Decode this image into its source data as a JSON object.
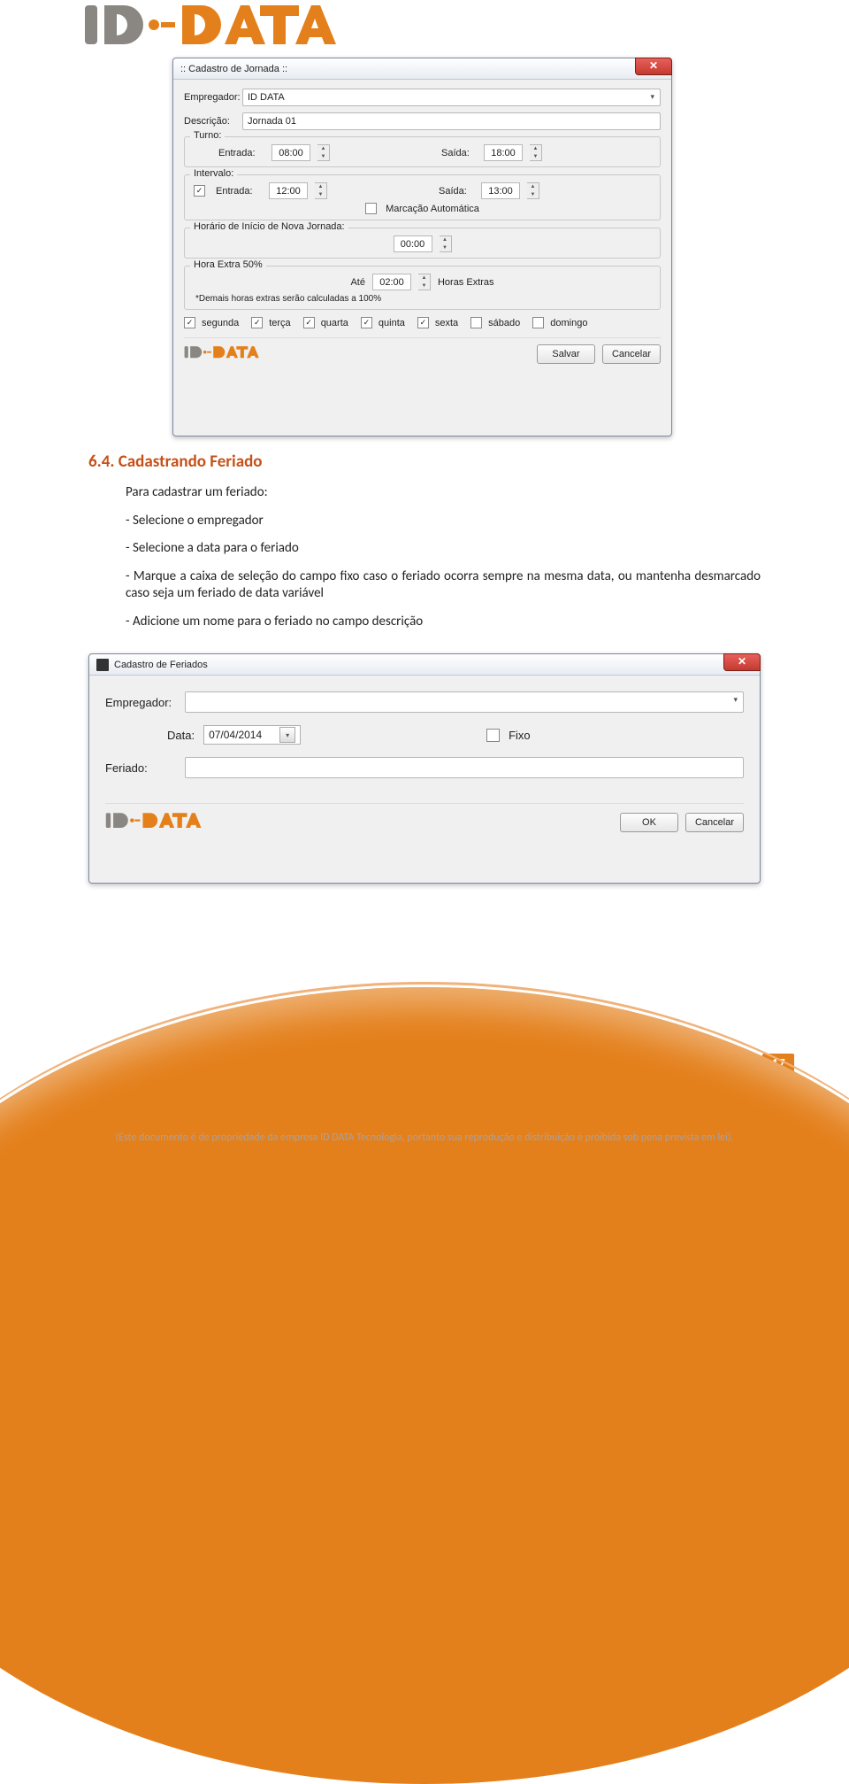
{
  "header": {
    "logo_text": "ID DATA"
  },
  "win1": {
    "title": ":: Cadastro de Jornada ::",
    "empregador_label": "Empregador:",
    "empregador_value": "ID DATA",
    "descricao_label": "Descrição:",
    "descricao_value": "Jornada 01",
    "turno": {
      "legend": "Turno:",
      "entrada_label": "Entrada:",
      "entrada_value": "08:00",
      "saida_label": "Saída:",
      "saida_value": "18:00"
    },
    "intervalo": {
      "legend": "Intervalo:",
      "checked": true,
      "entrada_label": "Entrada:",
      "entrada_value": "12:00",
      "saida_label": "Saída:",
      "saida_value": "13:00",
      "marcacao_label": "Marcação Automática",
      "marcacao_checked": false
    },
    "nova_jornada": {
      "legend": "Horário de Início de Nova Jornada:",
      "value": "00:00"
    },
    "hora_extra": {
      "legend": "Hora Extra 50%",
      "ate_label": "Até",
      "value": "02:00",
      "suffix": "Horas Extras",
      "note": "*Demais horas extras serão calculadas a 100%"
    },
    "days": [
      {
        "label": "segunda",
        "checked": true
      },
      {
        "label": "terça",
        "checked": true
      },
      {
        "label": "quarta",
        "checked": true
      },
      {
        "label": "quinta",
        "checked": true
      },
      {
        "label": "sexta",
        "checked": true
      },
      {
        "label": "sábado",
        "checked": false
      },
      {
        "label": "domingo",
        "checked": false
      }
    ],
    "save": "Salvar",
    "cancel": "Cancelar"
  },
  "section": {
    "heading": "6.4.     Cadastrando Feriado",
    "intro": "Para cadastrar um feriado:",
    "b1": "- Selecione o empregador",
    "b2": "- Selecione a data para o feriado",
    "b3": "- Marque a caixa de seleção do campo fixo caso o feriado ocorra sempre na mesma data, ou mantenha desmarcado caso seja um feriado de data variável",
    "b4": "- Adicione um nome para o feriado no campo descrição"
  },
  "win2": {
    "title": "Cadastro de Feriados",
    "empregador_label": "Empregador:",
    "empregador_value": "",
    "data_label": "Data:",
    "data_value": "07/04/2014",
    "fixo_label": "Fixo",
    "fixo_checked": false,
    "feriado_label": "Feriado:",
    "feriado_value": "",
    "ok": "OK",
    "cancel": "Cancelar"
  },
  "page_number": "17",
  "disclaimer": "(Este documento é de propriedade da empresa ID DATA Tecnologia, portanto sua reprodução e distribuição é proibida sob pena prevista em lei)."
}
